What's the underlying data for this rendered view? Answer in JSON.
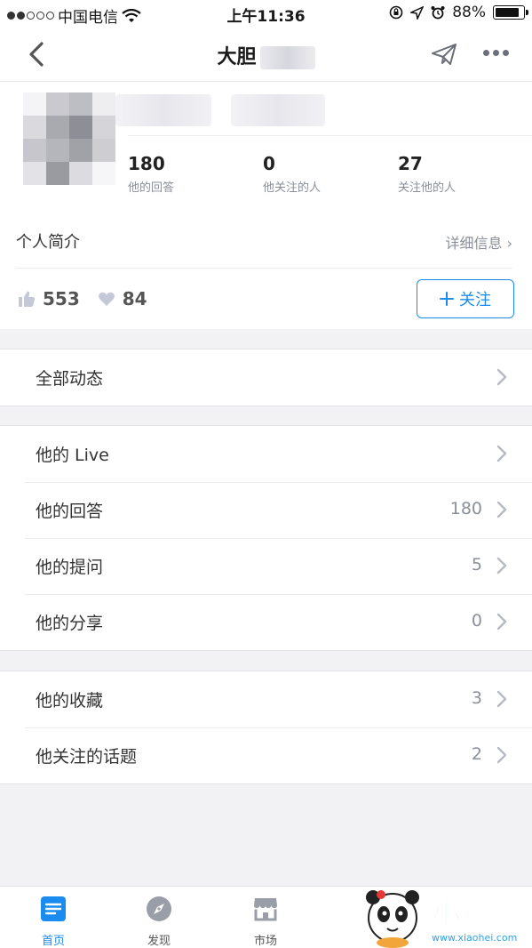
{
  "status_bar": {
    "carrier": "中国电信",
    "time": "上午11:36",
    "battery": "88%",
    "battery_level": 0.88
  },
  "nav": {
    "title": "大胆",
    "icons": [
      "back-icon",
      "send-icon",
      "more-icon"
    ]
  },
  "profile": {
    "stats": [
      {
        "num": "180",
        "label": "他的回答"
      },
      {
        "num": "0",
        "label": "他关注的人"
      },
      {
        "num": "27",
        "label": "关注他的人"
      }
    ],
    "intro_label": "个人简介",
    "detail_link": "详细信息 ›",
    "likes": "553",
    "thanks": "84",
    "follow_button": "关注"
  },
  "group1": [
    {
      "label": "全部动态",
      "value": ""
    }
  ],
  "group2": [
    {
      "label": "他的 Live",
      "value": ""
    },
    {
      "label": "他的回答",
      "value": "180"
    },
    {
      "label": "他的提问",
      "value": "5"
    },
    {
      "label": "他的分享",
      "value": "0"
    }
  ],
  "group3": [
    {
      "label": "他的收藏",
      "value": "3"
    },
    {
      "label": "他关注的话题",
      "value": "2"
    }
  ],
  "tabbar": [
    {
      "label": "首页",
      "active": true
    },
    {
      "label": "发现",
      "active": false
    },
    {
      "label": "市场",
      "active": false
    }
  ],
  "watermark": {
    "text": "小黑游戏",
    "url_text": "www.xiaohei.com"
  },
  "colors": {
    "accent": "#1a8cf0",
    "background": "#f2f2f5"
  }
}
